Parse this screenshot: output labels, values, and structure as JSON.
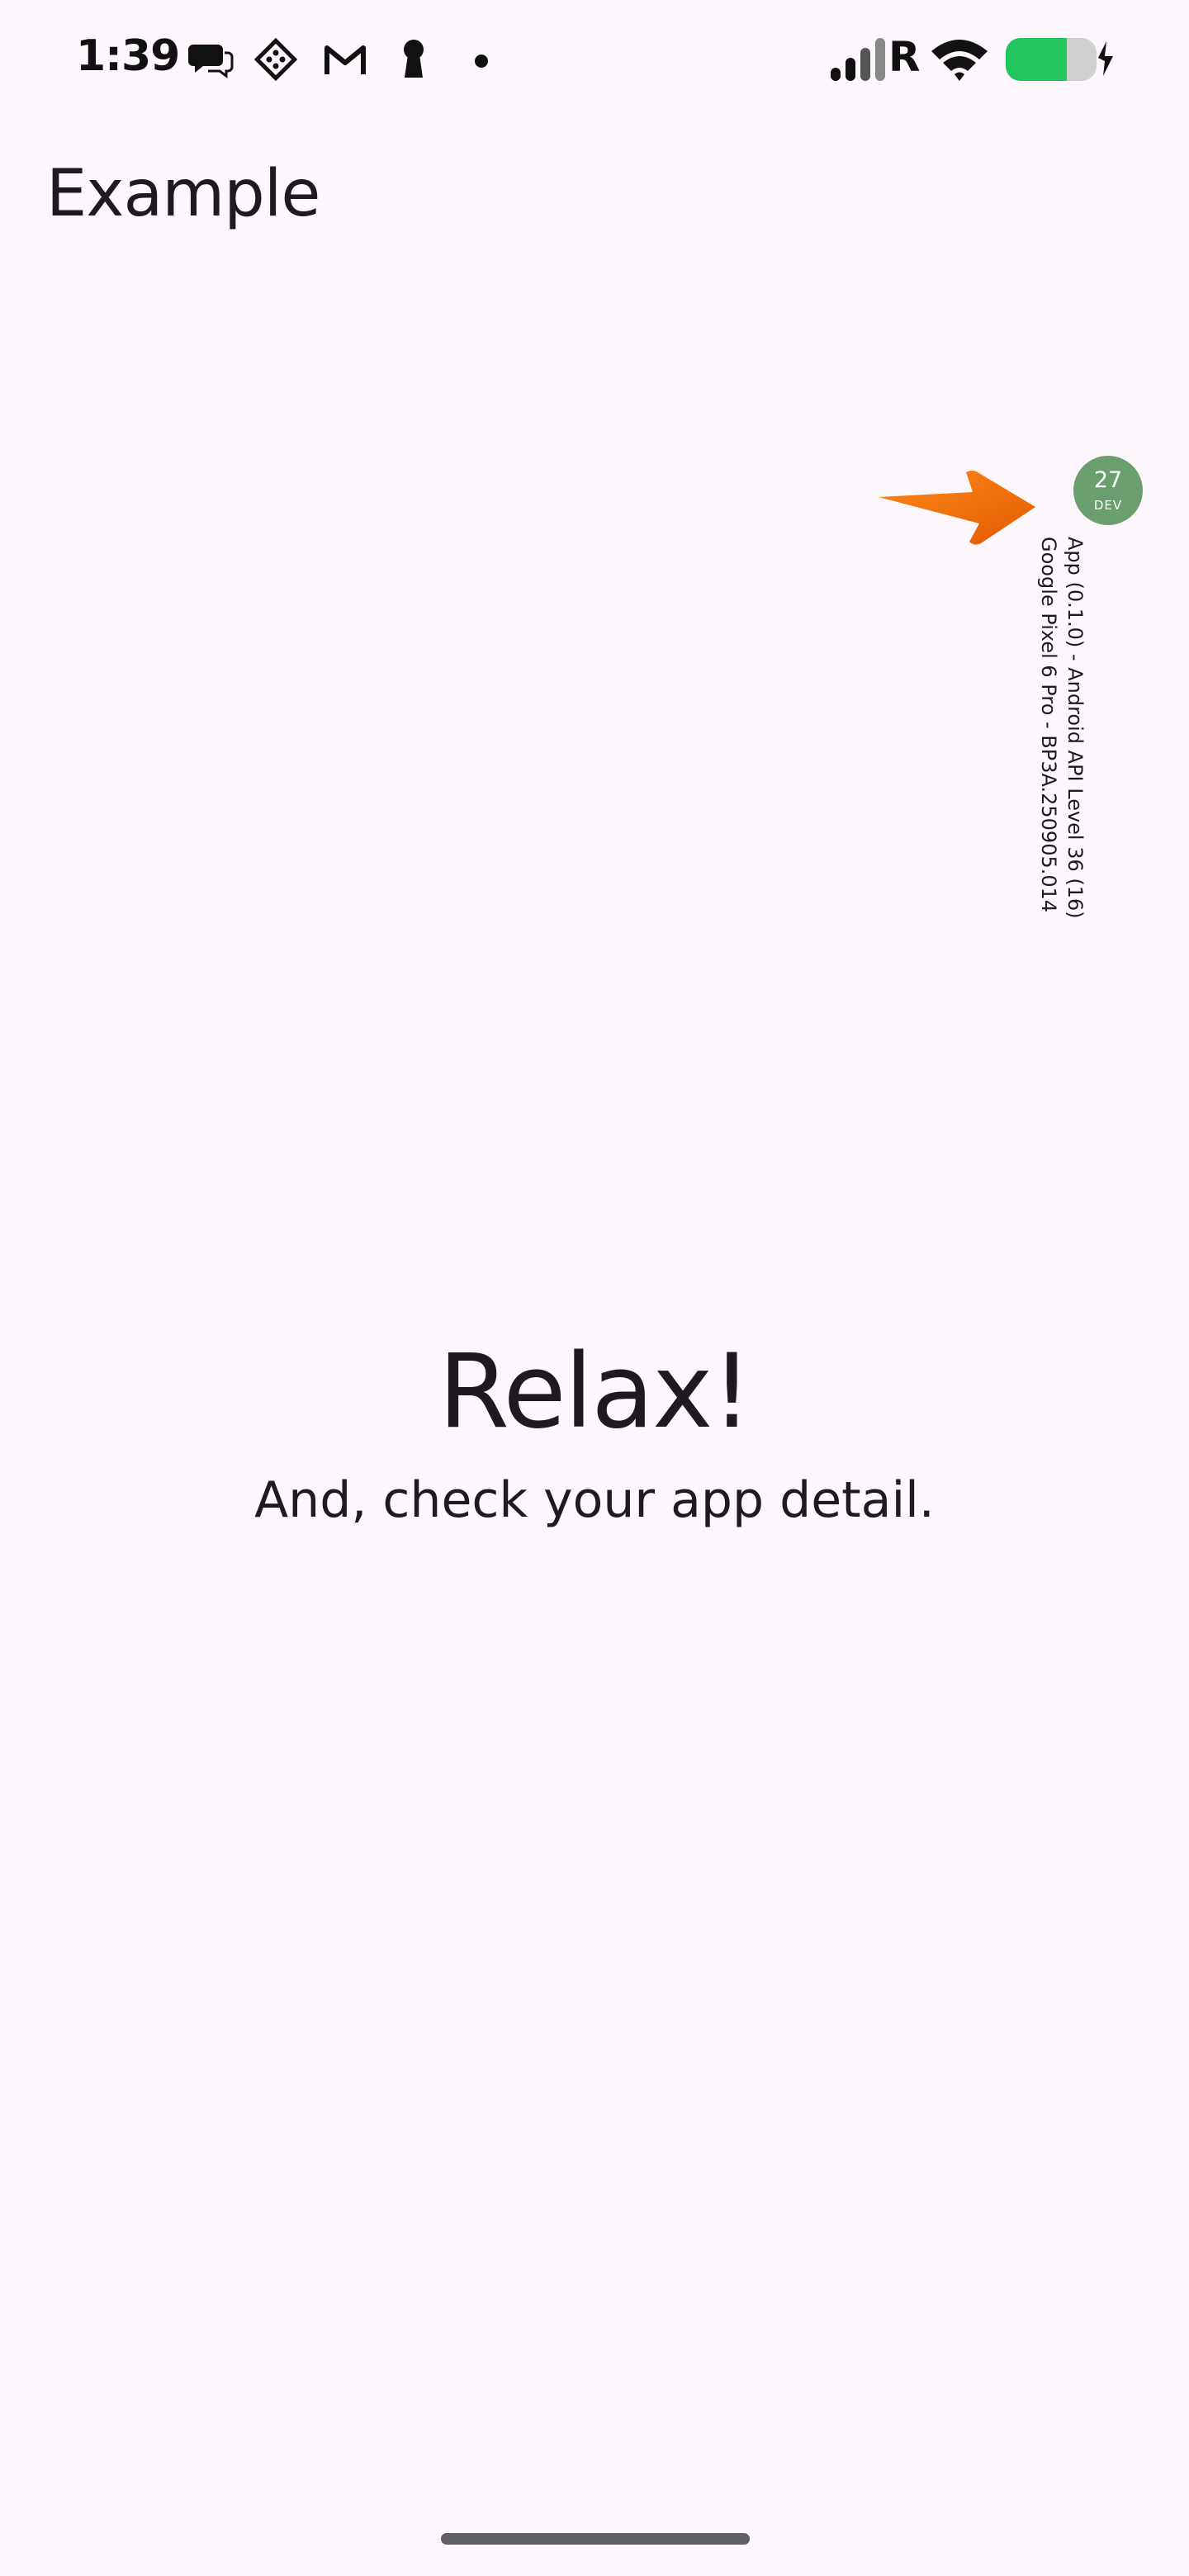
{
  "status_bar": {
    "time": "1:39",
    "left_icons": [
      "chat-icon",
      "game-icon",
      "gmail-icon",
      "keyhole-icon",
      "dot-icon"
    ],
    "network_label": "R",
    "right_icons": [
      "signal-icon",
      "wifi-icon",
      "battery-charging-icon"
    ],
    "battery_color": "#22c55e"
  },
  "app_bar": {
    "title": "Example"
  },
  "dev_badge": {
    "number": "27",
    "label": "DEV",
    "color": "#6a9e6c",
    "info_line1": "App (0.1.0) - Android API Level 36 (16)",
    "info_line2": "Google Pixel 6 Pro - BP3A.250905.014",
    "pointer_icon": "arrow-right-icon",
    "pointer_color": "#f07010"
  },
  "main": {
    "headline": "Relax!",
    "subline": "And, check your app detail."
  }
}
